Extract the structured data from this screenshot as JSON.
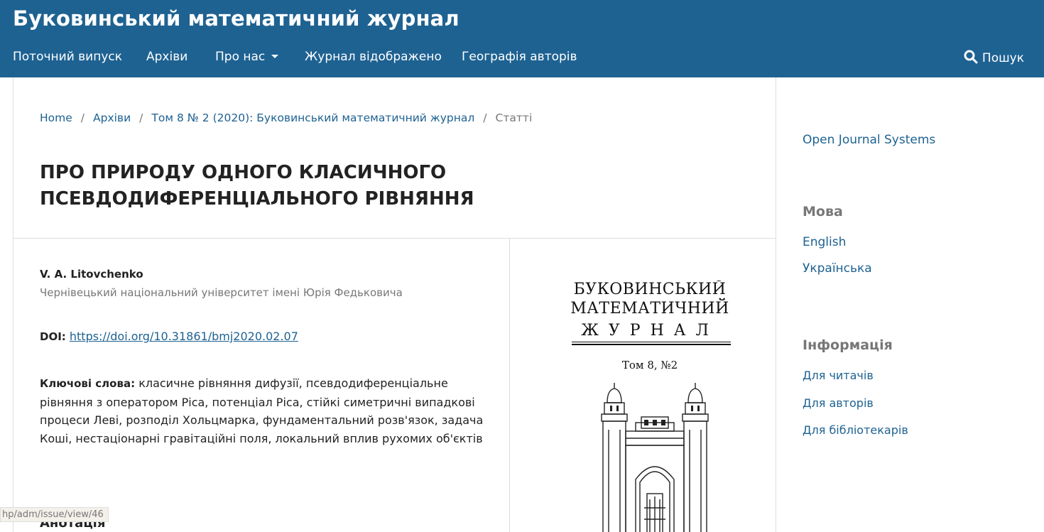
{
  "header": {
    "site_title": "Буковинський математичний журнал",
    "nav": [
      {
        "label": "Поточний випуск"
      },
      {
        "label": "Архіви"
      },
      {
        "label": "Про нас"
      },
      {
        "label": "Журнал відображено"
      },
      {
        "label": "Географія авторів"
      }
    ],
    "search_label": "Пошук"
  },
  "breadcrumb": {
    "home": "Home",
    "archives": "Архіви",
    "issue": "Том 8 № 2 (2020): Буковинський математичний журнал",
    "current": "Статті",
    "separator": "/"
  },
  "article": {
    "title_line1": "ПРО ПРИРОДУ ОДНОГО КЛАСИЧНОГО",
    "title_line2": "ПСЕВДОДИФЕРЕНЦІАЛЬНОГО РІВНЯННЯ",
    "author": "V. A. Litovchenko",
    "affiliation": "Чернівецький національний університет імені Юрія Федьковича",
    "doi_label": "DOI:",
    "doi_url": "https://doi.org/10.31861/bmj2020.02.07",
    "keywords_label": "Ключові слова:",
    "keywords_text": "класичне рівняння дифузії, псевдодиференціальне рівняння з оператором Ріса, потенціал Ріса, стійкі симетричні випадкові процеси Леві, розподіл Хольцмарка, фундаментальний розв'язок, задача Коші, нестаціонарні гравітаційні поля, локальний вплив рухомих об'єктів",
    "abstract_heading": "Анотація"
  },
  "cover": {
    "line1": "БУКОВИНСЬКИЙ",
    "line2": "МАТЕМАТИЧНИЙ",
    "line3": "ЖУРНАЛ",
    "volume": "Том 8, №2"
  },
  "status_bar": {
    "url": "hp/adm/issue/view/46"
  },
  "sidebar": {
    "ojs_link": "Open Journal Systems",
    "language_heading": "Мова",
    "languages": [
      "English",
      "Українська"
    ],
    "info_heading": "Інформація",
    "info_links": [
      "Для читачів",
      "Для авторів",
      "Для бібліотекарів"
    ]
  },
  "colors": {
    "header_bg": "#1e6292",
    "link": "#1e6292",
    "muted": "#777777"
  }
}
